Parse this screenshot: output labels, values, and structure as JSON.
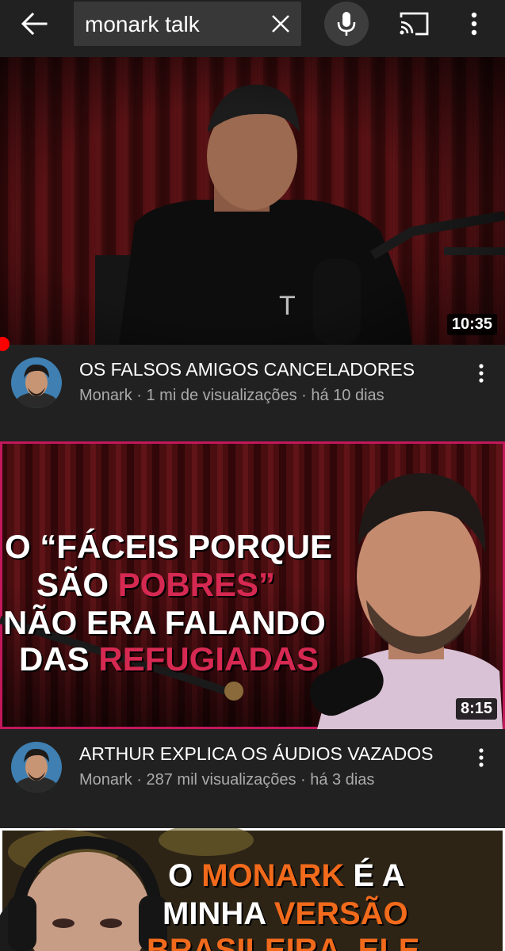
{
  "search": {
    "query": "monark talk"
  },
  "icons": {
    "back": "arrow-left-icon",
    "clear": "close-icon",
    "mic": "microphone-icon",
    "cast": "cast-icon",
    "more": "more-vert-icon"
  },
  "colors": {
    "background": "#212121",
    "search_box": "#383838",
    "progress": "#ff0000",
    "thumb2_accent": "#d62952",
    "thumb3_accent": "#f26a1b"
  },
  "videos": [
    {
      "title": "OS FALSOS AMIGOS CANCELADORES",
      "channel": "Monark",
      "views": "1 mi de visualizações",
      "age": "há 10 dias",
      "duration": "10:35",
      "thumbnail_text": []
    },
    {
      "title": "ARTHUR EXPLICA OS ÁUDIOS VAZADOS",
      "channel": "Monark",
      "views": "287 mil visualizações",
      "age": "há 3 dias",
      "duration": "8:15",
      "thumbnail_text": {
        "line1": "O “FÁCEIS PORQUE",
        "line2_a": "SÃO ",
        "line2_b": "POBRES”",
        "line3": "NÃO ERA FALANDO",
        "line4_a": "DAS ",
        "line4_b": "REFUGIADAS"
      }
    },
    {
      "thumbnail_text": {
        "line1_a": "O ",
        "line1_b": "MONARK",
        "line1_c": " É A",
        "line2_a": "MINHA ",
        "line2_b": "VERSÃO",
        "line3": "BRASILEIRA, ELE"
      }
    }
  ],
  "separator": " · "
}
